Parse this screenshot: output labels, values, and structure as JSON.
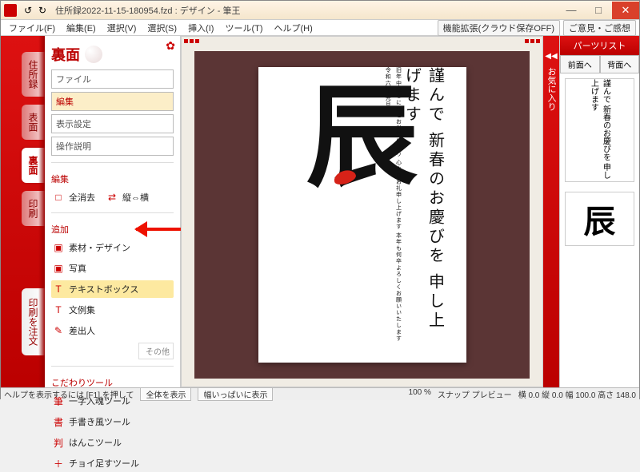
{
  "titlebar": {
    "app_title": "住所録2022-11-15-180954.fzd : デザイン - 筆王",
    "quick": [
      "↺",
      "↻"
    ]
  },
  "menubar": {
    "items": [
      "ファイル(F)",
      "編集(E)",
      "選択(V)",
      "選択(S)",
      "挿入(I)",
      "ツール(T)",
      "ヘルプ(H)"
    ],
    "right": [
      "機能拡張(クラウド保存OFF)",
      "ご意見・ご感想"
    ]
  },
  "ribbon": {
    "tabs": [
      "住所録",
      "表面",
      "裏面",
      "印刷"
    ],
    "selected": 2,
    "order_btn": "印刷を注文"
  },
  "panel": {
    "title": "裏面",
    "boxes": [
      "ファイル",
      "編集",
      "表示設定",
      "操作説明"
    ],
    "box_selected": 1,
    "sect_edit": "編集",
    "edit_items": [
      {
        "icon": "□",
        "label": "全消去"
      },
      {
        "icon": "⇄",
        "label": "縦⇔横"
      }
    ],
    "sect_add": "追加",
    "add_items": [
      {
        "icon": "▣",
        "label": "素材・デザイン"
      },
      {
        "icon": "▣",
        "label": "写真"
      },
      {
        "icon": "T",
        "label": "テキストボックス"
      },
      {
        "icon": "T",
        "label": "文例集"
      },
      {
        "icon": "✎",
        "label": "差出人"
      }
    ],
    "add_highlight": 2,
    "more": "その他",
    "sect_tool": "こだわりツール",
    "tool_items": [
      {
        "icon": "筆",
        "label": "一字入魂ツール"
      },
      {
        "icon": "書",
        "label": "手書き風ツール"
      },
      {
        "icon": "判",
        "label": "はんこツール"
      },
      {
        "icon": "＋",
        "label": "チョイ足すツール"
      }
    ]
  },
  "canvas": {
    "calligraphy": "辰",
    "greet": "謹んで\n新春のお慶びを\n申し上げます",
    "subtext": "旧年中はなにかとお世話になり\n心よりお礼申し上げます\n本年も何卒よろしくお願いいたします\n令和六年 元旦"
  },
  "fav": {
    "label": "お気に入り"
  },
  "parts": {
    "header": "パーツリスト",
    "btns": [
      "前面へ",
      "背面へ"
    ],
    "thumb1": "謹んで\n新春のお慶びを\n申し上げます",
    "thumb2": "辰"
  },
  "status": {
    "help": "ヘルプを表示するには [F1] を押して",
    "segs": [
      "全体を表示",
      "幅いっぱいに表示"
    ],
    "zoom_icons": [
      "□",
      "□"
    ],
    "zoom": "100 %",
    "mode": "スナップ プレビュー",
    "coords": "横 0.0 縦 0.0 幅 100.0 高さ 148.0"
  }
}
